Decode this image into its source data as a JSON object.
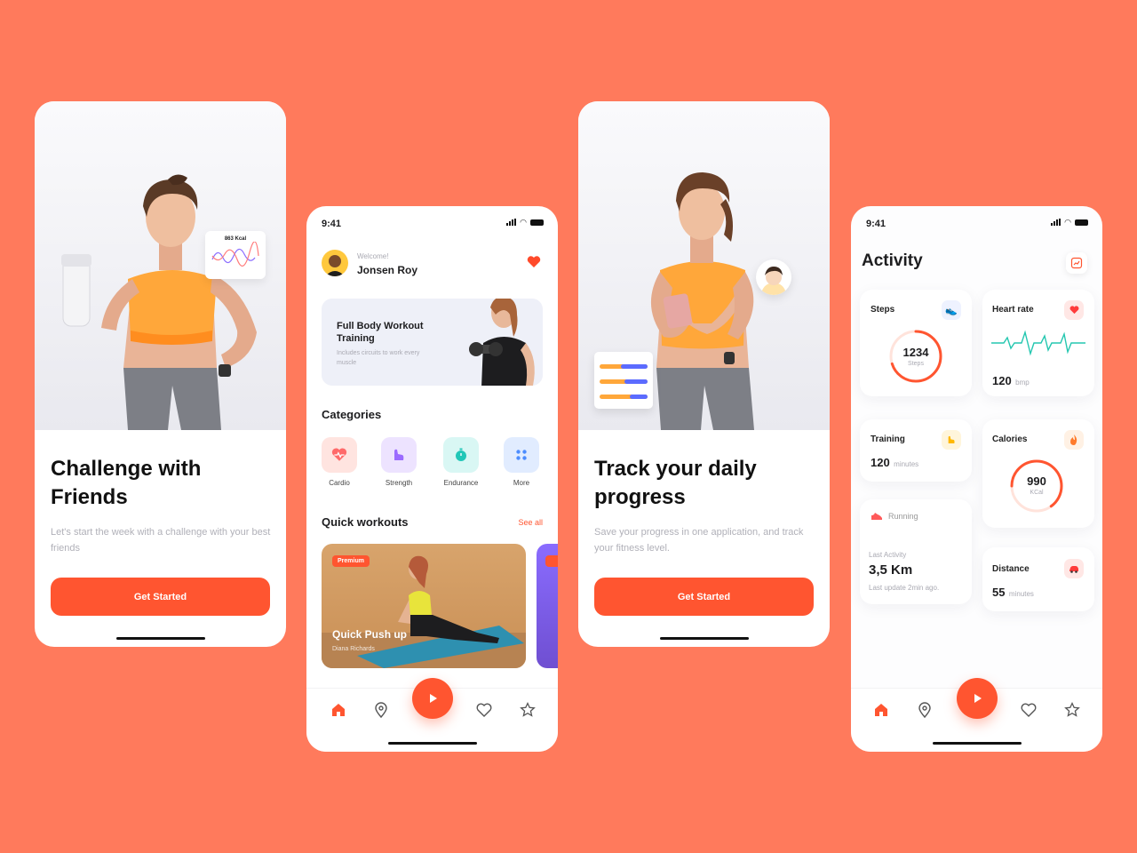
{
  "screen1": {
    "chart_card": {
      "value": "863 Kcal"
    },
    "title": "Challenge with Friends",
    "description": "Let's start the week with a challenge with your best friends",
    "button": "Get Started"
  },
  "screen2": {
    "status": {
      "time": "9:41"
    },
    "header": {
      "welcome": "Welcome!",
      "name": "Jonsen Roy"
    },
    "banner": {
      "title": "Full Body Workout Training",
      "subtitle": "Includes circuits to work every muscle"
    },
    "categories_title": "Categories",
    "categories": [
      {
        "label": "Cardio",
        "icon": "heart-pulse-icon",
        "bg": "#FFE4E0",
        "fg": "#FF5A5A"
      },
      {
        "label": "Strength",
        "icon": "muscle-icon",
        "bg": "#EDE3FF",
        "fg": "#9B6BFF"
      },
      {
        "label": "Endurance",
        "icon": "stopwatch-icon",
        "bg": "#D9F7F4",
        "fg": "#22C7B8"
      },
      {
        "label": "More",
        "icon": "grid-icon",
        "bg": "#E1ECFF",
        "fg": "#4D8DFF"
      }
    ],
    "quick_title": "Quick workouts",
    "see_all": "See all",
    "workouts": [
      {
        "badge": "Premium",
        "title": "Quick Push up",
        "author": "Diana Richards"
      }
    ]
  },
  "screen3": {
    "title": "Track your daily progress",
    "description": "Save your progress in one application, and track your fitness level.",
    "button": "Get Started"
  },
  "screen4": {
    "status": {
      "time": "9:41"
    },
    "title": "Activity",
    "steps": {
      "label": "Steps",
      "value": "1234",
      "unit": "Steps",
      "progress": 0.7
    },
    "heart": {
      "label": "Heart rate",
      "value": "120",
      "unit": "bmp"
    },
    "training": {
      "label": "Training",
      "value": "120",
      "unit": "minutes"
    },
    "calories": {
      "label": "Calories",
      "value": "990",
      "unit": "KCal",
      "progress": 0.65
    },
    "running": {
      "label": "Running",
      "sub": "Last Activity",
      "value": "3,5 Km",
      "updated": "Last update 2min ago."
    },
    "distance": {
      "label": "Distance",
      "value": "55",
      "unit": "minutes"
    }
  },
  "colors": {
    "accent": "#FF5530",
    "background": "#FF7A5C",
    "teal": "#25C7B0"
  }
}
